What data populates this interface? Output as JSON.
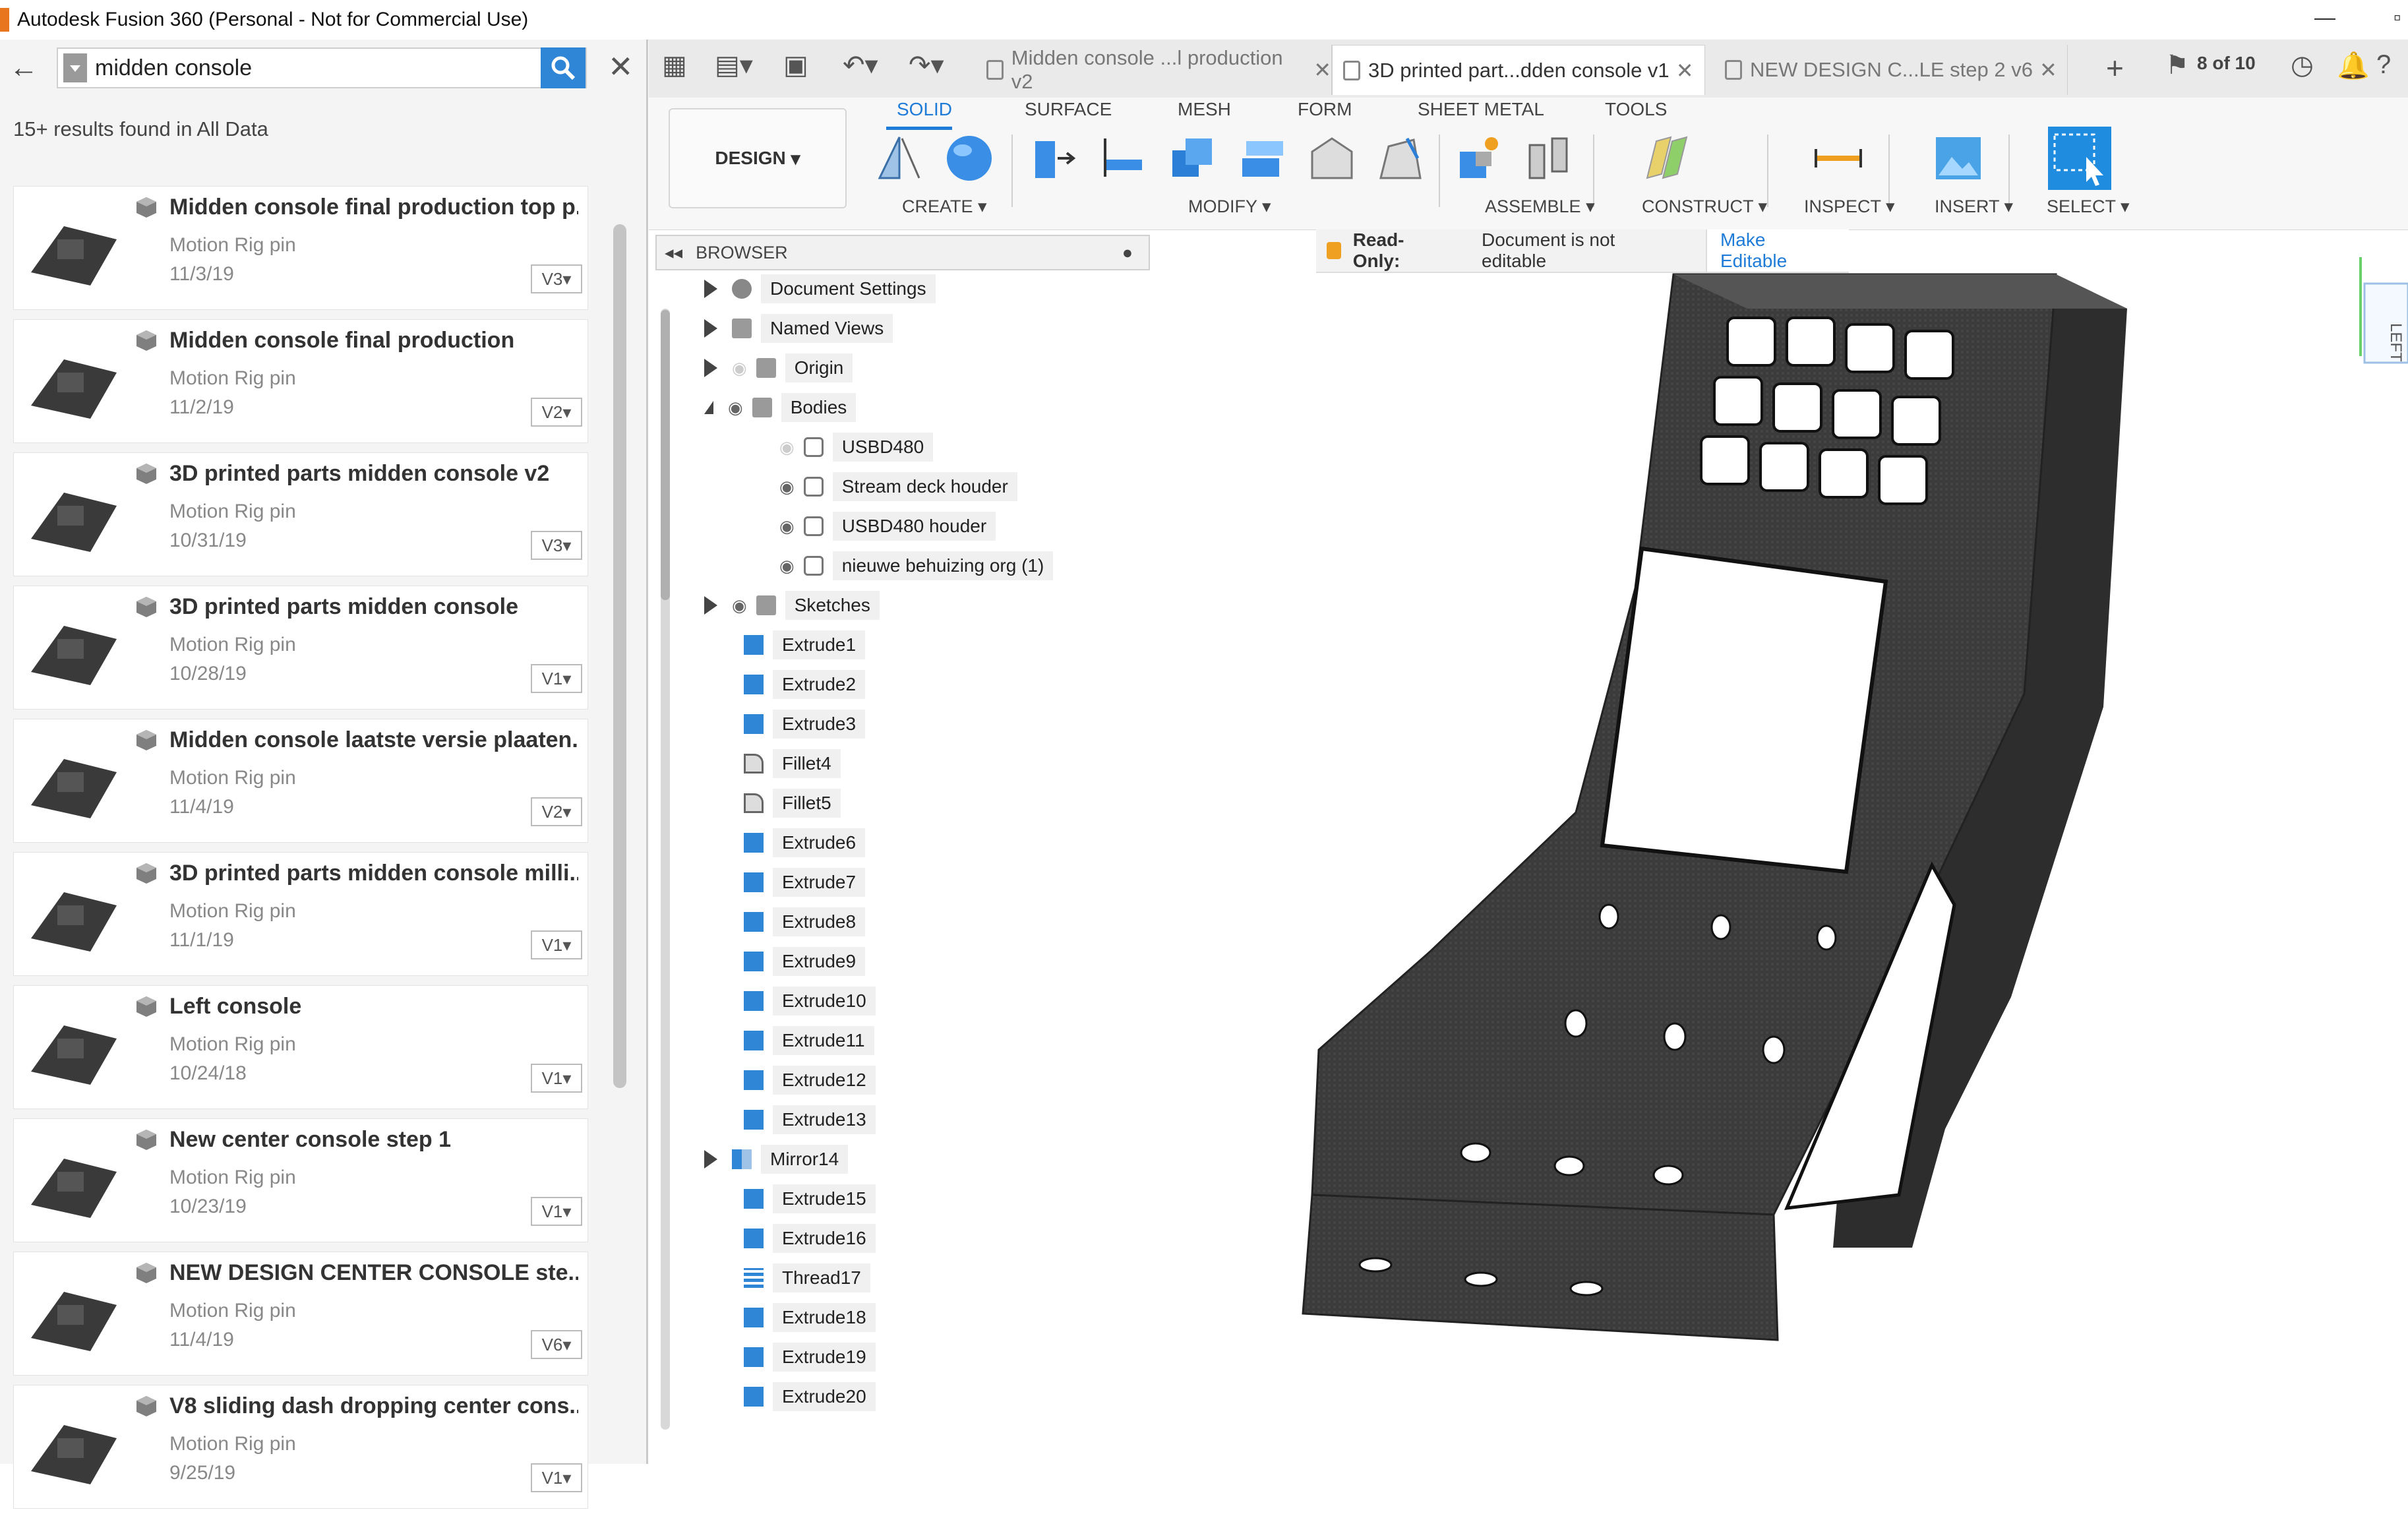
{
  "window": {
    "title": "Autodesk Fusion 360 (Personal - Not for Commercial Use)"
  },
  "data_panel": {
    "search": {
      "value": "midden console",
      "placeholder": ""
    },
    "results_text": "15+ results found in All Data",
    "items": [
      {
        "name": "Midden console final production top p...",
        "project": "Motion Rig pin",
        "date": "11/3/19",
        "version": "V3"
      },
      {
        "name": "Midden console final production",
        "project": "Motion Rig pin",
        "date": "11/2/19",
        "version": "V2"
      },
      {
        "name": "3D printed parts midden console v2",
        "project": "Motion Rig pin",
        "date": "10/31/19",
        "version": "V3"
      },
      {
        "name": "3D printed parts midden console",
        "project": "Motion Rig pin",
        "date": "10/28/19",
        "version": "V1"
      },
      {
        "name": "Midden console laatste versie plaaten...",
        "project": "Motion Rig pin",
        "date": "11/4/19",
        "version": "V2"
      },
      {
        "name": "3D printed parts midden console milli...",
        "project": "Motion Rig pin",
        "date": "11/1/19",
        "version": "V1"
      },
      {
        "name": "Left console",
        "project": "Motion Rig pin",
        "date": "10/24/18",
        "version": "V1"
      },
      {
        "name": "New center console step 1",
        "project": "Motion Rig pin",
        "date": "10/23/19",
        "version": "V1"
      },
      {
        "name": "NEW DESIGN CENTER CONSOLE ste...",
        "project": "Motion Rig pin",
        "date": "11/4/19",
        "version": "V6"
      },
      {
        "name": "V8 sliding dash dropping center cons...",
        "project": "Motion Rig pin",
        "date": "9/25/19",
        "version": "V1"
      }
    ]
  },
  "tabs": [
    {
      "label": "Midden console ...l production v2",
      "active": false
    },
    {
      "label": "3D printed part...dden console v1",
      "active": true
    },
    {
      "label": "NEW DESIGN C...LE step 2 v6",
      "active": false
    }
  ],
  "tab_counter": "8 of 10",
  "ribbon": {
    "workspace": "DESIGN",
    "tabs": [
      "SOLID",
      "SURFACE",
      "MESH",
      "FORM",
      "SHEET METAL",
      "TOOLS"
    ],
    "groups": [
      "CREATE",
      "MODIFY",
      "ASSEMBLE",
      "CONSTRUCT",
      "INSPECT",
      "INSERT",
      "SELECT"
    ]
  },
  "browser": {
    "title": "BROWSER",
    "top": [
      {
        "label": "Document Settings"
      },
      {
        "label": "Named Views"
      },
      {
        "label": "Origin"
      },
      {
        "label": "Bodies"
      }
    ],
    "bodies": [
      {
        "label": "USBD480"
      },
      {
        "label": "Stream deck houder"
      },
      {
        "label": "USBD480 houder"
      },
      {
        "label": "nieuwe behuizing org (1)"
      }
    ],
    "sketches": "Sketches",
    "features": [
      "Extrude1",
      "Extrude2",
      "Extrude3",
      "Fillet4",
      "Fillet5",
      "Extrude6",
      "Extrude7",
      "Extrude8",
      "Extrude9",
      "Extrude10",
      "Extrude11",
      "Extrude12",
      "Extrude13",
      "Mirror14",
      "Extrude15",
      "Extrude16",
      "Thread17",
      "Extrude18",
      "Extrude19",
      "Extrude20"
    ]
  },
  "readonly": {
    "label": "Read-Only:",
    "message": "Document is not editable",
    "action": "Make Editable"
  },
  "viewcube": {
    "face": "LEFT"
  },
  "colors": {
    "accent": "#1f7bd8",
    "search_button": "#2f86d6",
    "lock": "#f0a020",
    "app_icon": "#e8761f"
  }
}
